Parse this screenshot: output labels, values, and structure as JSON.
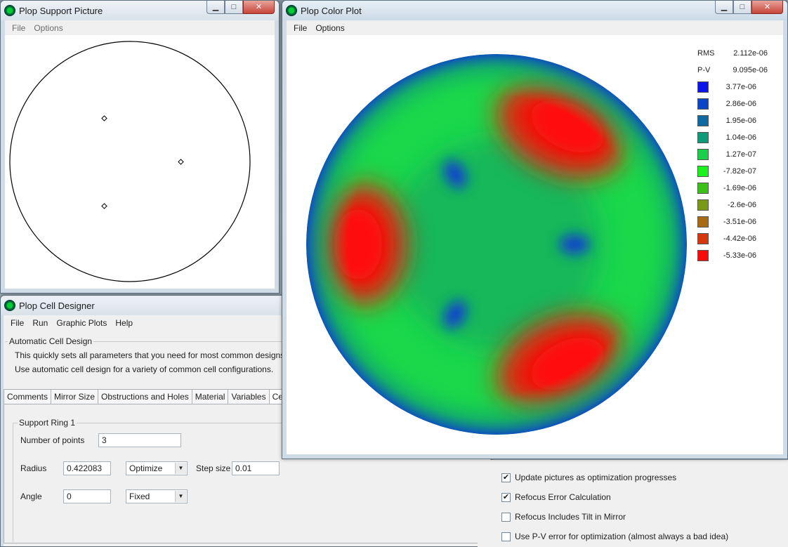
{
  "support_window": {
    "title": "Plop Support Picture",
    "menu": [
      "File",
      "Options"
    ]
  },
  "color_window": {
    "title": "Plop Color Plot",
    "menu": [
      "File",
      "Options"
    ],
    "legend": {
      "rms_label": "RMS",
      "rms_value": "2.112e-06",
      "pv_label": "P-V",
      "pv_value": "9.095e-06",
      "entries": [
        {
          "value": "3.77e-06",
          "color": "#0a16e8"
        },
        {
          "value": "2.86e-06",
          "color": "#0c44c8"
        },
        {
          "value": "1.95e-06",
          "color": "#0e6aa0"
        },
        {
          "value": "1.04e-06",
          "color": "#0f9a78"
        },
        {
          "value": "1.27e-07",
          "color": "#1ad04a"
        },
        {
          "value": "-7.82e-07",
          "color": "#1cf21c"
        },
        {
          "value": "-1.69e-06",
          "color": "#3ac21a"
        },
        {
          "value": "-2.6e-06",
          "color": "#789a16"
        },
        {
          "value": "-3.51e-06",
          "color": "#a86a12"
        },
        {
          "value": "-4.42e-06",
          "color": "#d6380c"
        },
        {
          "value": "-5.33e-06",
          "color": "#f80a08"
        }
      ]
    }
  },
  "cell_window": {
    "title": "Plop Cell Designer",
    "menu": [
      "File",
      "Run",
      "Graphic Plots",
      "Help"
    ],
    "auto_group_label": "Automatic Cell Design",
    "auto_line1": "This quickly sets all parameters that you need for most common designs.",
    "auto_line2": "Use automatic cell design for a variety of common cell configurations.",
    "tabs": [
      "Comments",
      "Mirror Size",
      "Obstructions and Holes",
      "Material",
      "Variables",
      "Cell Type"
    ],
    "ring_label": "Support Ring 1",
    "num_points_label": "Number of points",
    "num_points_value": "3",
    "radius_label": "Radius",
    "radius_value": "0.422083",
    "radius_mode": "Optimize",
    "step_label": "Step size",
    "step_value": "0.01",
    "angle_label": "Angle",
    "angle_value": "0",
    "angle_mode": "Fixed"
  },
  "options_panel": {
    "checkboxes": [
      {
        "label": "Update pictures as optimization progresses",
        "checked": true
      },
      {
        "label": "Refocus Error Calculation",
        "checked": true
      },
      {
        "label": "Refocus Includes Tilt in Mirror",
        "checked": false
      },
      {
        "label": "Use P-V error for optimization (almost always a bad idea)",
        "checked": false
      }
    ]
  }
}
